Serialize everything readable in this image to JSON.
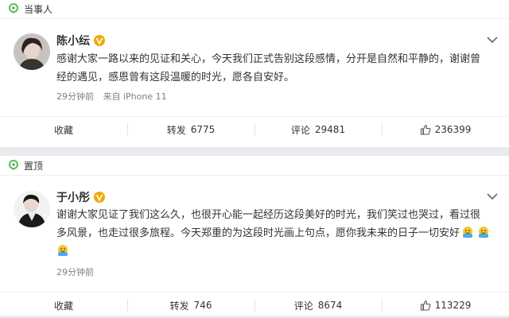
{
  "posts": [
    {
      "tag": "当事人",
      "author": "陈小纭",
      "line1": "感谢大家一路以来的见证和关心，今天我们正式告别这段感情，分开是自然和平静的，谢谢曾",
      "line2": "经的遇见，感恩曾有这段温暖的时光，愿各自安好。",
      "time": "29分钟前",
      "source": "来自 iPhone 11",
      "actions": {
        "favorite": "收藏",
        "repost_label": "转发",
        "repost_count": "6775",
        "comment_label": "评论",
        "comment_count": "29481",
        "like_count": "236399"
      }
    },
    {
      "tag": "置顶",
      "author": "于小彤",
      "line1": "谢谢大家见证了我们这么久，也很开心能一起经历这段美好的时光，我们笑过也哭过，看过很",
      "line2": "多风景，也走过很多旅程。今天郑重的为这段时光画上句点，愿你我未来的日子一切安好",
      "time": "29分钟前",
      "actions": {
        "favorite": "收藏",
        "repost_label": "转发",
        "repost_count": "746",
        "comment_label": "评论",
        "comment_count": "8674",
        "like_count": "113229"
      }
    }
  ],
  "icons": {
    "pin": "location-pin-icon",
    "verified": "verified-v-icon",
    "more": "chevron-down-icon",
    "like": "thumbs-up-icon",
    "emoji": "hug-emoji-icon"
  },
  "colors": {
    "pin_green": "#5cb85c",
    "verified_gold": "#f2a900",
    "meta_gray": "#808080"
  }
}
